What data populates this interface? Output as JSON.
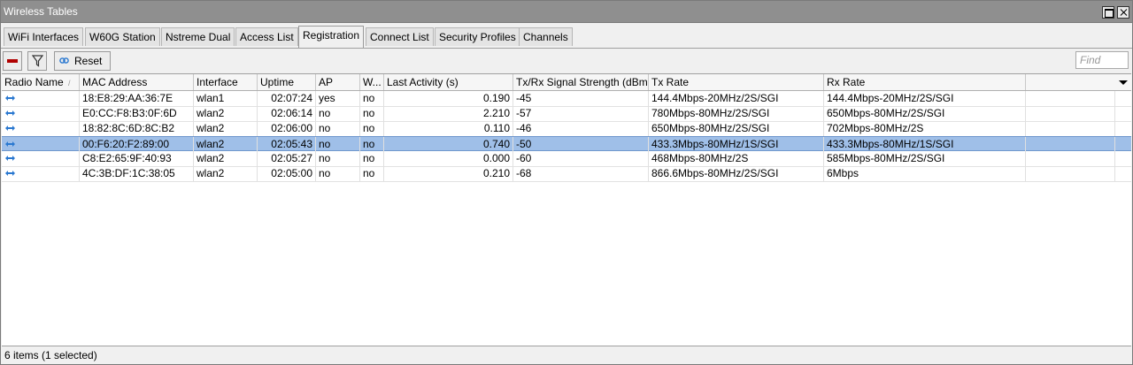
{
  "window": {
    "title": "Wireless Tables"
  },
  "tabs": [
    {
      "label": "WiFi Interfaces"
    },
    {
      "label": "W60G Station"
    },
    {
      "label": "Nstreme Dual"
    },
    {
      "label": "Access List"
    },
    {
      "label": "Registration",
      "active": true
    },
    {
      "label": "Connect List"
    },
    {
      "label": "Security Profiles"
    },
    {
      "label": "Channels"
    }
  ],
  "toolbar": {
    "remove_icon": "remove-icon",
    "filter_icon": "filter-icon",
    "reset_label": "Reset",
    "find_placeholder": "Find"
  },
  "columns": [
    "Radio Name",
    "MAC Address",
    "Interface",
    "Uptime",
    "AP",
    "W...",
    "Last Activity (s)",
    "Tx/Rx Signal Strength (dBm)",
    "Tx Rate",
    "Rx Rate"
  ],
  "rows": [
    {
      "radio_icon": "radio-link-icon",
      "mac": "18:E8:29:AA:36:7E",
      "interface": "wlan1",
      "uptime": "02:07:24",
      "ap": "yes",
      "w": "no",
      "last_activity": "0.190",
      "signal": "-45",
      "tx_rate": "144.4Mbps-20MHz/2S/SGI",
      "rx_rate": "144.4Mbps-20MHz/2S/SGI"
    },
    {
      "radio_icon": "radio-link-icon",
      "mac": "E0:CC:F8:B3:0F:6D",
      "interface": "wlan2",
      "uptime": "02:06:14",
      "ap": "no",
      "w": "no",
      "last_activity": "2.210",
      "signal": "-57",
      "tx_rate": "780Mbps-80MHz/2S/SGI",
      "rx_rate": "650Mbps-80MHz/2S/SGI"
    },
    {
      "radio_icon": "radio-link-icon",
      "mac": "18:82:8C:6D:8C:B2",
      "interface": "wlan2",
      "uptime": "02:06:00",
      "ap": "no",
      "w": "no",
      "last_activity": "0.110",
      "signal": "-46",
      "tx_rate": "650Mbps-80MHz/2S/SGI",
      "rx_rate": "702Mbps-80MHz/2S"
    },
    {
      "radio_icon": "radio-link-icon",
      "mac": "00:F6:20:F2:89:00",
      "interface": "wlan2",
      "uptime": "02:05:43",
      "ap": "no",
      "w": "no",
      "last_activity": "0.740",
      "signal": "-50",
      "tx_rate": "433.3Mbps-80MHz/1S/SGI",
      "rx_rate": "433.3Mbps-80MHz/1S/SGI",
      "selected": true
    },
    {
      "radio_icon": "radio-link-icon",
      "mac": "C8:E2:65:9F:40:93",
      "interface": "wlan2",
      "uptime": "02:05:27",
      "ap": "no",
      "w": "no",
      "last_activity": "0.000",
      "signal": "-60",
      "tx_rate": "468Mbps-80MHz/2S",
      "rx_rate": "585Mbps-80MHz/2S/SGI"
    },
    {
      "radio_icon": "radio-link-icon",
      "mac": "4C:3B:DF:1C:38:05",
      "interface": "wlan2",
      "uptime": "02:05:00",
      "ap": "no",
      "w": "no",
      "last_activity": "0.210",
      "signal": "-68",
      "tx_rate": "866.6Mbps-80MHz/2S/SGI",
      "rx_rate": "6Mbps"
    }
  ],
  "status": {
    "text": "6 items (1 selected)"
  },
  "colors": {
    "titlebar": "#8f8f8f",
    "selection": "#9fbfe8",
    "remove": "#b00000",
    "radio_icon": "#2a78d0"
  }
}
